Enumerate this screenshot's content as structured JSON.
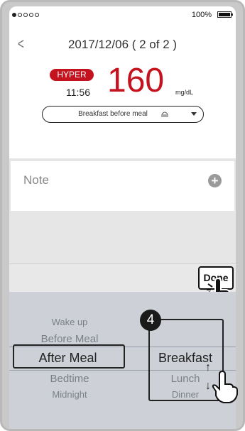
{
  "status_bar": {
    "battery": "100%"
  },
  "header": {
    "date": "2017/12/06 ( 2 of 2 )",
    "badge": "HYPER",
    "time": "11:56",
    "glucose": "160",
    "unit": "mg/dL",
    "meal_dropdown": "Breakfast before meal"
  },
  "note": {
    "label": "Note"
  },
  "toolbar": {
    "done": "Done"
  },
  "picker": {
    "left_column": [
      "Wake up",
      "Before Meal",
      "After Meal",
      "Bedtime",
      "Midnight"
    ],
    "right_column": [
      "Breakfast",
      "Lunch",
      "Dinner"
    ]
  },
  "annotation": {
    "step": "4",
    "up": "↑",
    "down": "↓"
  },
  "colors": {
    "accent": "#c4131e",
    "picker_bg": "#cdd0d6"
  }
}
